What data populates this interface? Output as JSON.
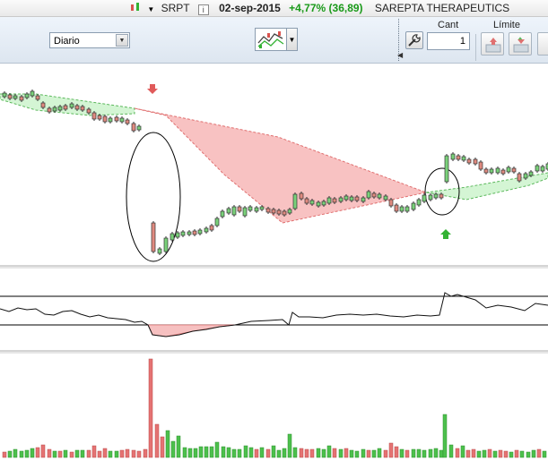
{
  "header": {
    "symbol": "SRPT",
    "info_label": "i",
    "date": "02-sep-2015",
    "change": "+4,77% (36,89)",
    "company": "SAREPTA THERAPEUTICS"
  },
  "toolbar": {
    "period_select": {
      "value": "Diario"
    },
    "quantity_label": "Cant",
    "quantity_value": "1",
    "limit_label": "Límite"
  },
  "colors": {
    "up": "#33b233",
    "down": "#d9534f",
    "band_green": "#d4f5d4",
    "band_red": "#f8c2c2",
    "arrow_down": "#e05a5a",
    "arrow_up": "#33b233"
  },
  "icons": [
    "chart-type-icon",
    "wrench-icon",
    "buy-limit-icon",
    "sell-limit-icon",
    "arrow-down-signal-icon",
    "arrow-up-signal-icon"
  ]
}
